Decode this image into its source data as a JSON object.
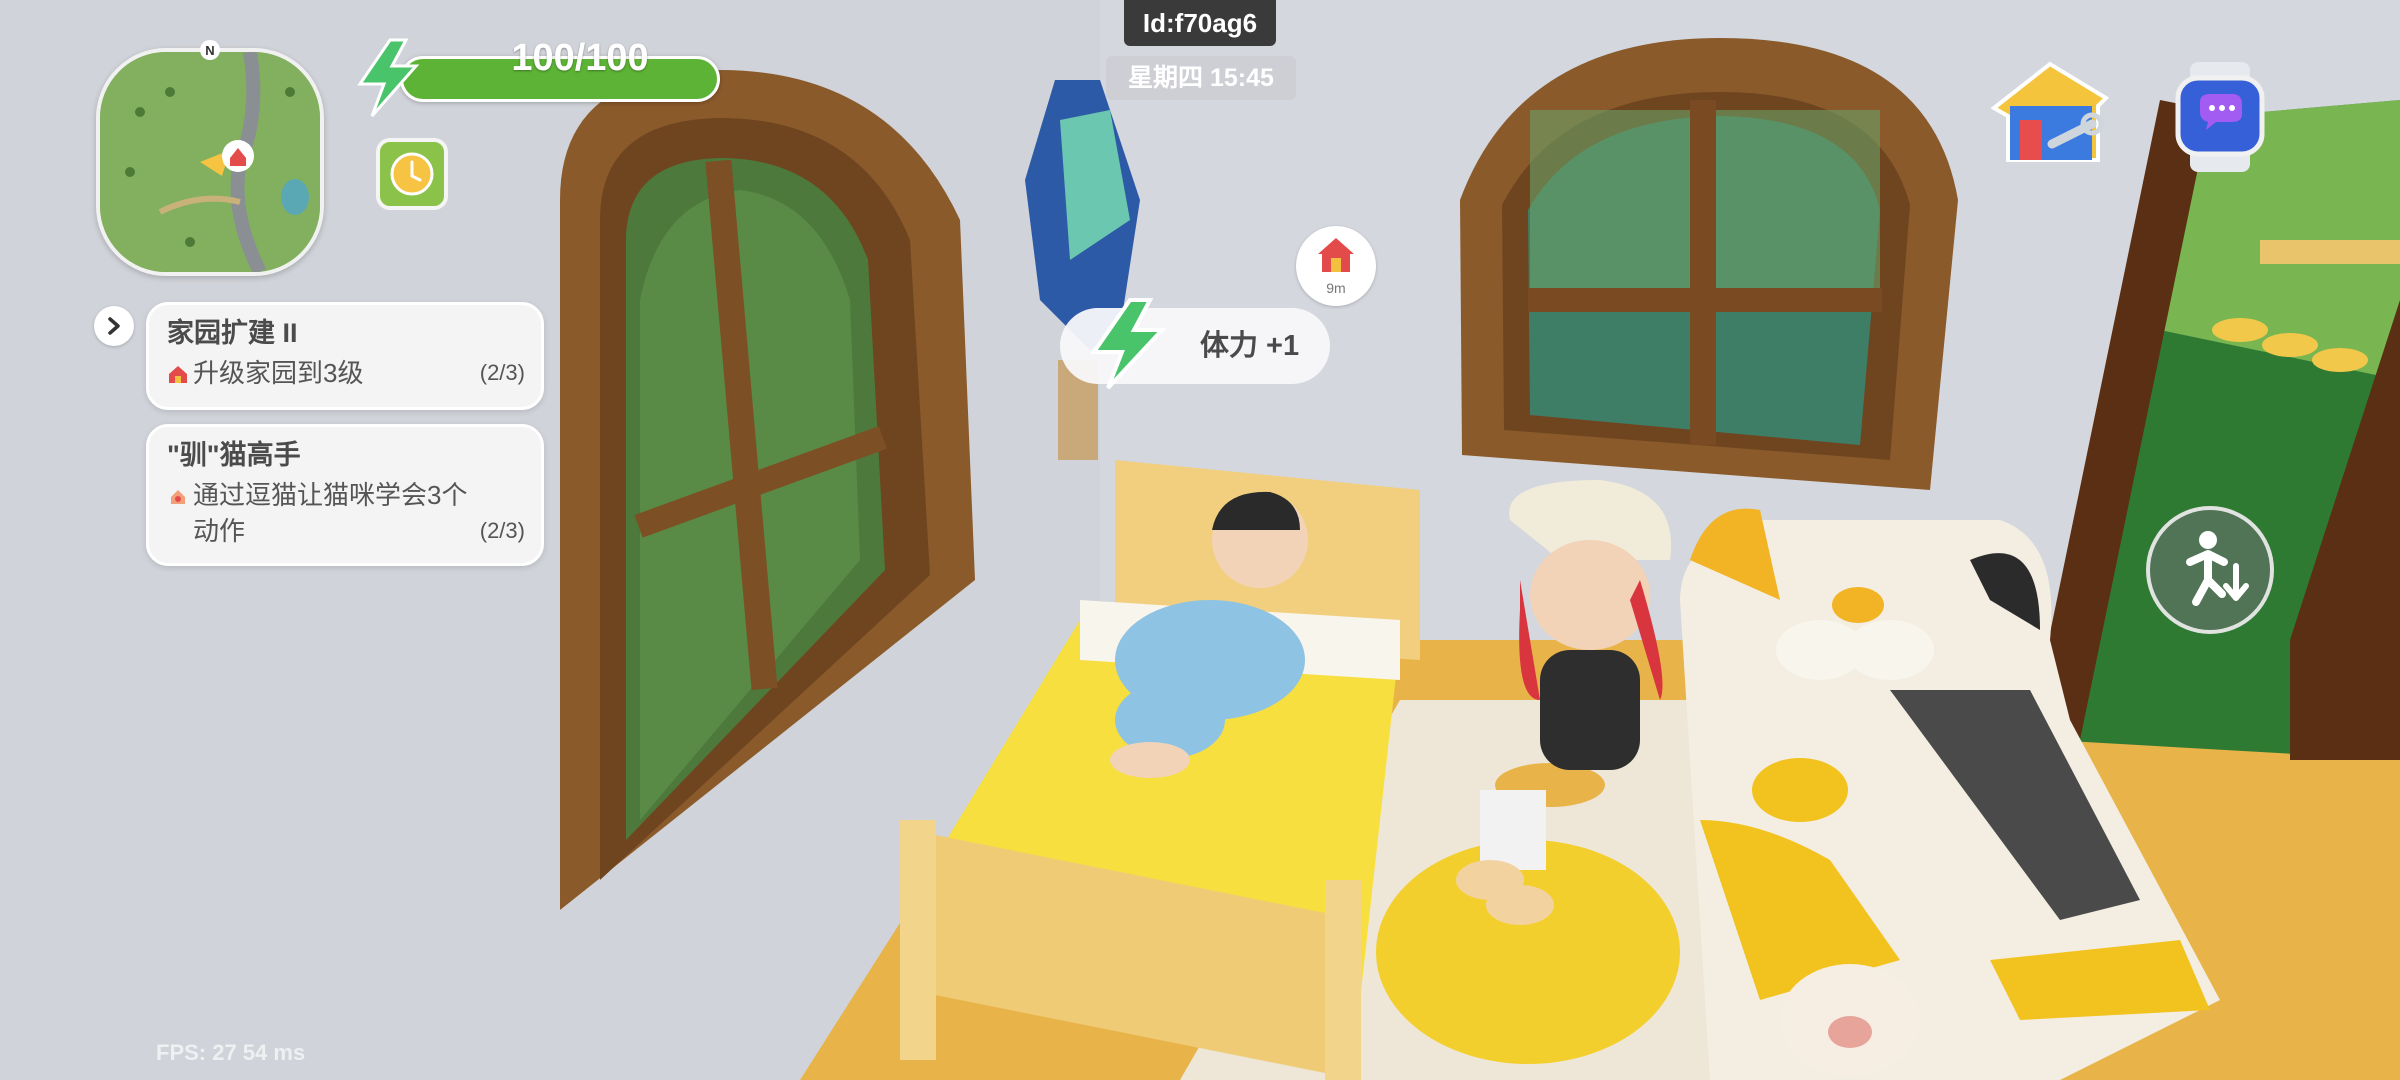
{
  "hud": {
    "player_id": "Id:f70ag6",
    "datetime": "星期四 15:45",
    "compass_label": "N",
    "stamina": {
      "text": "100/100",
      "current": 100,
      "max": 100
    },
    "fps_text": "FPS: 27  54 ms"
  },
  "toast": {
    "text": "体力 +1"
  },
  "home_marker": {
    "distance": "9m"
  },
  "quests": [
    {
      "title": "家园扩建 II",
      "description": "升级家园到3级",
      "progress": "(2/3)"
    },
    {
      "title": "\"驯\"猫高手",
      "description": "通过逗猫让猫咪学会3个动作",
      "progress": "(2/3)"
    }
  ],
  "icons": {
    "stamina": "lightning-bolt-icon",
    "clock": "clock-icon",
    "quest_toggle": "chevron-right-icon",
    "home": "house-icon",
    "house_button": "house-wrench-icon",
    "watch_button": "smartwatch-chat-icon",
    "action_button": "stand-up-icon"
  },
  "colors": {
    "stamina_green": "#5db336",
    "bolt_green": "#49c46a",
    "wall": "#d3d6dc",
    "wood": "#8a5a2b",
    "blanket_yellow": "#f4d431"
  }
}
